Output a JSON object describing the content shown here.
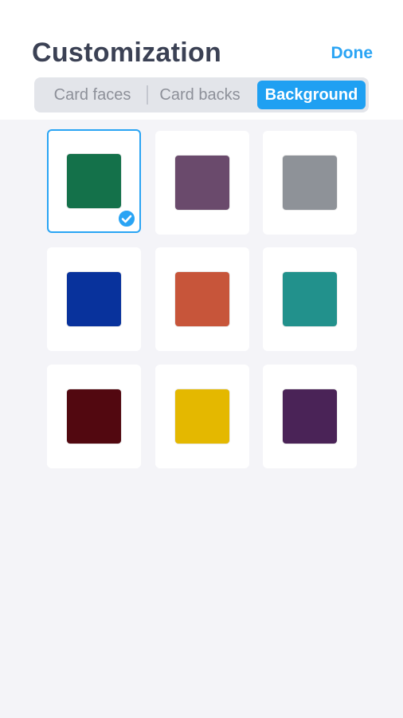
{
  "header": {
    "title": "Customization",
    "done_label": "Done"
  },
  "tabs": [
    {
      "label": "Card faces",
      "active": false
    },
    {
      "label": "Card backs",
      "active": false
    },
    {
      "label": "Background",
      "active": true
    }
  ],
  "colors": {
    "accent": "#2aa4f4",
    "title": "#3b4154",
    "page_bg": "#f4f4f8"
  },
  "backgrounds": [
    {
      "name": "green",
      "color": "#14714a",
      "selected": true
    },
    {
      "name": "mauve",
      "color": "#6a4a6c",
      "selected": false
    },
    {
      "name": "gray",
      "color": "#8e9298",
      "selected": false
    },
    {
      "name": "blue",
      "color": "#08329c",
      "selected": false
    },
    {
      "name": "orange",
      "color": "#c7553a",
      "selected": false
    },
    {
      "name": "teal",
      "color": "#22918c",
      "selected": false
    },
    {
      "name": "maroon",
      "color": "#520810",
      "selected": false
    },
    {
      "name": "yellow",
      "color": "#e4b800",
      "selected": false
    },
    {
      "name": "purple",
      "color": "#4a2357",
      "selected": false
    }
  ]
}
